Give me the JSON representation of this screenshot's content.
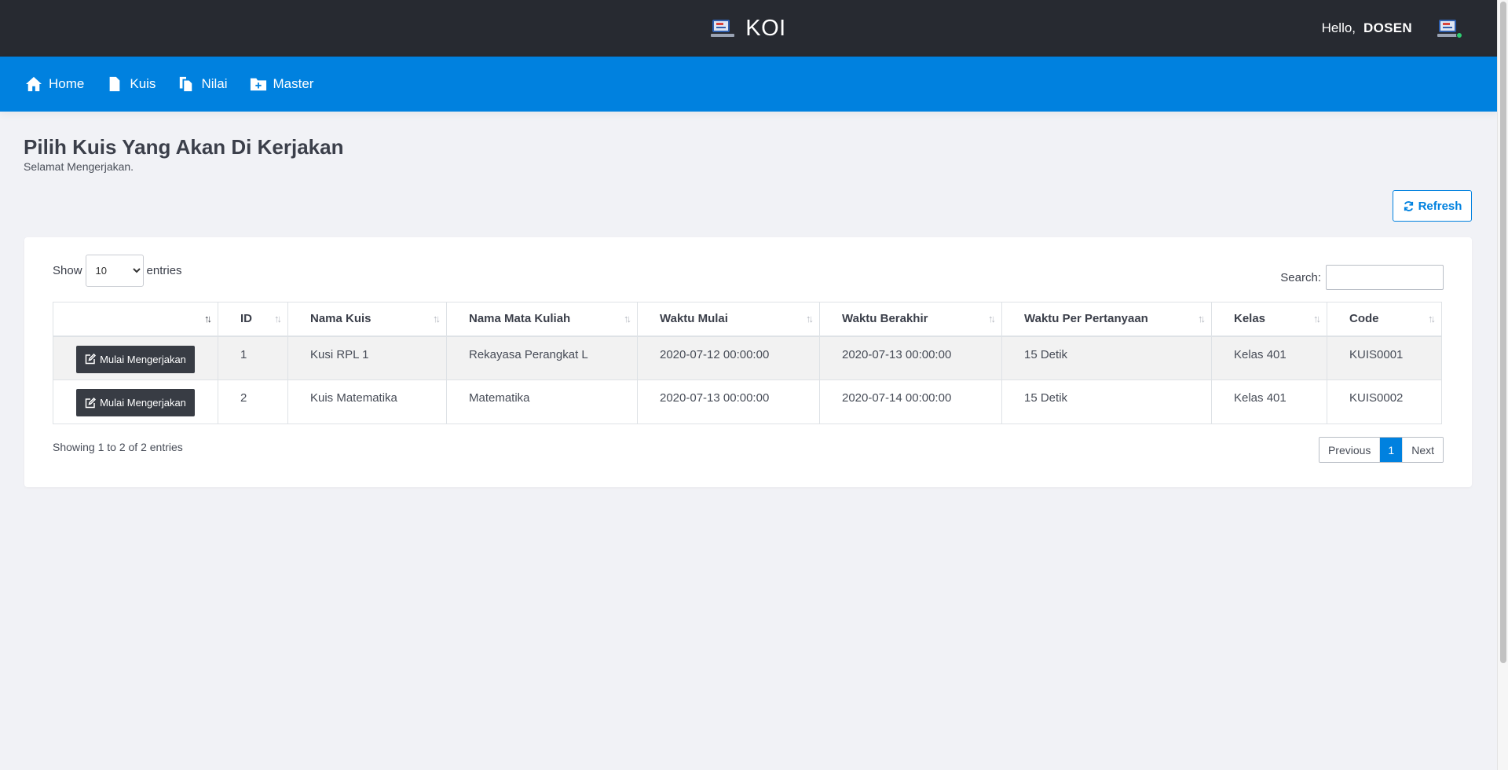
{
  "app": {
    "title": "KOI"
  },
  "user": {
    "greeting": "Hello,",
    "name": "DOSEN"
  },
  "nav": [
    {
      "label": "Home",
      "icon": "home-icon"
    },
    {
      "label": "Kuis",
      "icon": "file-icon"
    },
    {
      "label": "Nilai",
      "icon": "copy-icon"
    },
    {
      "label": "Master",
      "icon": "folder-plus-icon"
    }
  ],
  "page": {
    "title": "Pilih Kuis Yang Akan Di Kerjakan",
    "subtitle": "Selamat Mengerjakan.",
    "refresh_label": "Refresh"
  },
  "table": {
    "show_label": "Show",
    "entries_label": "entries",
    "page_length": "10",
    "search_label": "Search:",
    "search_value": "",
    "columns": [
      "",
      "ID",
      "Nama Kuis",
      "Nama Mata Kuliah",
      "Waktu Mulai",
      "Waktu Berakhir",
      "Waktu Per Pertanyaan",
      "Kelas",
      "Code"
    ],
    "action_label": "Mulai Mengerjakan",
    "rows": [
      [
        "1",
        "Kusi RPL 1",
        "Rekayasa Perangkat L",
        "2020-07-12 00:00:00",
        "2020-07-13 00:00:00",
        "15 Detik",
        "Kelas 401",
        "KUIS0001"
      ],
      [
        "2",
        "Kuis Matematika",
        "Matematika",
        "2020-07-13 00:00:00",
        "2020-07-14 00:00:00",
        "15 Detik",
        "Kelas 401",
        "KUIS0002"
      ]
    ],
    "info": "Showing 1 to 2 of 2 entries",
    "pagination": {
      "previous": "Previous",
      "current": "1",
      "next": "Next"
    }
  },
  "colors": {
    "topbar": "#272a31",
    "nav": "#0081df",
    "accent": "#0081df",
    "button_dark": "#383c44"
  }
}
